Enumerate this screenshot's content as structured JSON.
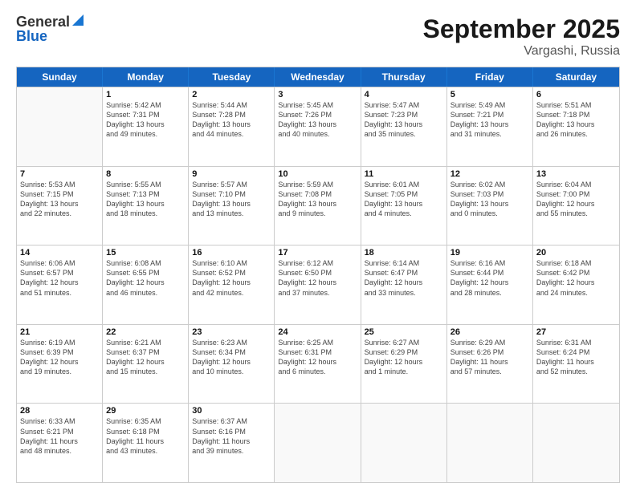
{
  "header": {
    "logo_general": "General",
    "logo_blue": "Blue",
    "month_title": "September 2025",
    "subtitle": "Vargashi, Russia"
  },
  "days": [
    "Sunday",
    "Monday",
    "Tuesday",
    "Wednesday",
    "Thursday",
    "Friday",
    "Saturday"
  ],
  "weeks": [
    [
      {
        "day": "",
        "info": ""
      },
      {
        "day": "1",
        "info": "Sunrise: 5:42 AM\nSunset: 7:31 PM\nDaylight: 13 hours\nand 49 minutes."
      },
      {
        "day": "2",
        "info": "Sunrise: 5:44 AM\nSunset: 7:28 PM\nDaylight: 13 hours\nand 44 minutes."
      },
      {
        "day": "3",
        "info": "Sunrise: 5:45 AM\nSunset: 7:26 PM\nDaylight: 13 hours\nand 40 minutes."
      },
      {
        "day": "4",
        "info": "Sunrise: 5:47 AM\nSunset: 7:23 PM\nDaylight: 13 hours\nand 35 minutes."
      },
      {
        "day": "5",
        "info": "Sunrise: 5:49 AM\nSunset: 7:21 PM\nDaylight: 13 hours\nand 31 minutes."
      },
      {
        "day": "6",
        "info": "Sunrise: 5:51 AM\nSunset: 7:18 PM\nDaylight: 13 hours\nand 26 minutes."
      }
    ],
    [
      {
        "day": "7",
        "info": "Sunrise: 5:53 AM\nSunset: 7:15 PM\nDaylight: 13 hours\nand 22 minutes."
      },
      {
        "day": "8",
        "info": "Sunrise: 5:55 AM\nSunset: 7:13 PM\nDaylight: 13 hours\nand 18 minutes."
      },
      {
        "day": "9",
        "info": "Sunrise: 5:57 AM\nSunset: 7:10 PM\nDaylight: 13 hours\nand 13 minutes."
      },
      {
        "day": "10",
        "info": "Sunrise: 5:59 AM\nSunset: 7:08 PM\nDaylight: 13 hours\nand 9 minutes."
      },
      {
        "day": "11",
        "info": "Sunrise: 6:01 AM\nSunset: 7:05 PM\nDaylight: 13 hours\nand 4 minutes."
      },
      {
        "day": "12",
        "info": "Sunrise: 6:02 AM\nSunset: 7:03 PM\nDaylight: 13 hours\nand 0 minutes."
      },
      {
        "day": "13",
        "info": "Sunrise: 6:04 AM\nSunset: 7:00 PM\nDaylight: 12 hours\nand 55 minutes."
      }
    ],
    [
      {
        "day": "14",
        "info": "Sunrise: 6:06 AM\nSunset: 6:57 PM\nDaylight: 12 hours\nand 51 minutes."
      },
      {
        "day": "15",
        "info": "Sunrise: 6:08 AM\nSunset: 6:55 PM\nDaylight: 12 hours\nand 46 minutes."
      },
      {
        "day": "16",
        "info": "Sunrise: 6:10 AM\nSunset: 6:52 PM\nDaylight: 12 hours\nand 42 minutes."
      },
      {
        "day": "17",
        "info": "Sunrise: 6:12 AM\nSunset: 6:50 PM\nDaylight: 12 hours\nand 37 minutes."
      },
      {
        "day": "18",
        "info": "Sunrise: 6:14 AM\nSunset: 6:47 PM\nDaylight: 12 hours\nand 33 minutes."
      },
      {
        "day": "19",
        "info": "Sunrise: 6:16 AM\nSunset: 6:44 PM\nDaylight: 12 hours\nand 28 minutes."
      },
      {
        "day": "20",
        "info": "Sunrise: 6:18 AM\nSunset: 6:42 PM\nDaylight: 12 hours\nand 24 minutes."
      }
    ],
    [
      {
        "day": "21",
        "info": "Sunrise: 6:19 AM\nSunset: 6:39 PM\nDaylight: 12 hours\nand 19 minutes."
      },
      {
        "day": "22",
        "info": "Sunrise: 6:21 AM\nSunset: 6:37 PM\nDaylight: 12 hours\nand 15 minutes."
      },
      {
        "day": "23",
        "info": "Sunrise: 6:23 AM\nSunset: 6:34 PM\nDaylight: 12 hours\nand 10 minutes."
      },
      {
        "day": "24",
        "info": "Sunrise: 6:25 AM\nSunset: 6:31 PM\nDaylight: 12 hours\nand 6 minutes."
      },
      {
        "day": "25",
        "info": "Sunrise: 6:27 AM\nSunset: 6:29 PM\nDaylight: 12 hours\nand 1 minute."
      },
      {
        "day": "26",
        "info": "Sunrise: 6:29 AM\nSunset: 6:26 PM\nDaylight: 11 hours\nand 57 minutes."
      },
      {
        "day": "27",
        "info": "Sunrise: 6:31 AM\nSunset: 6:24 PM\nDaylight: 11 hours\nand 52 minutes."
      }
    ],
    [
      {
        "day": "28",
        "info": "Sunrise: 6:33 AM\nSunset: 6:21 PM\nDaylight: 11 hours\nand 48 minutes."
      },
      {
        "day": "29",
        "info": "Sunrise: 6:35 AM\nSunset: 6:18 PM\nDaylight: 11 hours\nand 43 minutes."
      },
      {
        "day": "30",
        "info": "Sunrise: 6:37 AM\nSunset: 6:16 PM\nDaylight: 11 hours\nand 39 minutes."
      },
      {
        "day": "",
        "info": ""
      },
      {
        "day": "",
        "info": ""
      },
      {
        "day": "",
        "info": ""
      },
      {
        "day": "",
        "info": ""
      }
    ]
  ]
}
